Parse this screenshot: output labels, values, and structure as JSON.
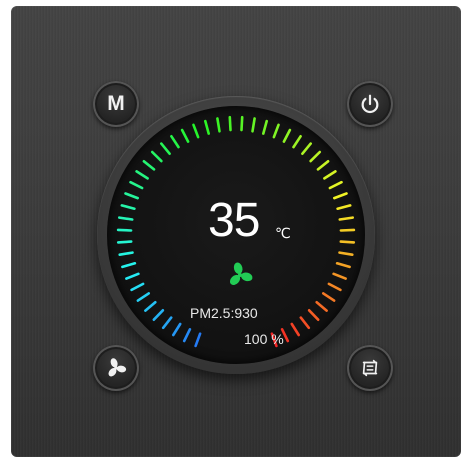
{
  "panel": {
    "buttons": {
      "mode_label": "M",
      "power_icon": "power-icon",
      "fan_icon": "fan-icon",
      "swap_icon": "mode-swap-icon"
    },
    "display": {
      "temperature": "35",
      "temperature_unit": "℃",
      "status_icon": "fan-icon",
      "pm25_text": "PM2.5:930",
      "percent_text": "100 %"
    },
    "colors": {
      "fan_indicator": "#22cc55",
      "scale_cold": "#1e88ff",
      "scale_mid": "#22dd88",
      "scale_warm": "#eedd22",
      "scale_hot": "#ee3322"
    }
  }
}
